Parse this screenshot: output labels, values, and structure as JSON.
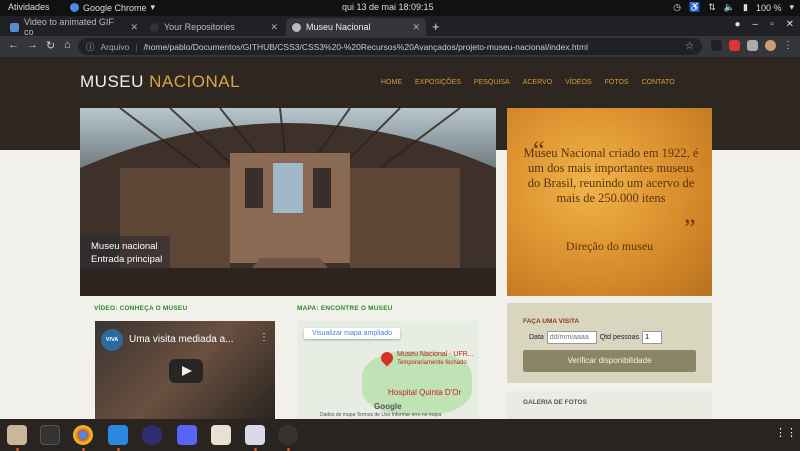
{
  "topbar": {
    "activities": "Atividades",
    "app_name": "Google Chrome",
    "clock": "qui 13 de mai  18:09:15",
    "battery": "100 %"
  },
  "tabs": [
    {
      "label": "Video to animated GIF co",
      "active": false
    },
    {
      "label": "Your Repositories",
      "active": false
    },
    {
      "label": "Museu Nacional",
      "active": true
    }
  ],
  "address": {
    "label": "Arquivo",
    "url": "/home/pablo/Documentos/GITHUB/CSS3/CSS3%20-%20Recursos%20Avançados/projeto-museu-nacional/index.html"
  },
  "site": {
    "logo_main": "MUSEU",
    "logo_accent": "NACIONAL",
    "menu": [
      "HOME",
      "EXPOSIÇÕES",
      "PESQUISA",
      "ACERVO",
      "VÍDEOS",
      "FOTOS",
      "CONTATO"
    ],
    "hero_caption_line1": "Museu nacional",
    "hero_caption_line2": "Entrada principal",
    "quote_text": "Museu Nacional criado em 1922, é um dos mais importantes museus do Brasil, reunindo um acervo de mais de 250.000 itens",
    "quote_author": "Direção do museu",
    "video_section_title": "VÍDEO: CONHEÇA O MUSEU",
    "video_title": "Uma visita mediada a...",
    "video_channel": "VIVA",
    "map_section_title": "MAPA: ENCONTRE O MUSEU",
    "map_button": "Visualizar mapa ampliado",
    "map_place": "Museu Nacional - UFR...",
    "map_place_note": "Temporariamente fechado",
    "map_hospital": "Hospital Quinta D'Or",
    "map_logo": "Google",
    "map_terms": "Dados do mapa   Termos de Uso   Informar erro no mapa",
    "visit_title": "FAÇA UMA VISITA",
    "visit_date_label": "Data",
    "visit_date_placeholder": "dd/mm/aaaa",
    "visit_qty_label": "Qtd pessoas",
    "visit_qty_value": "1",
    "visit_button": "Verificar disponibilidade",
    "gallery_title": "GALERIA DE FOTOS"
  }
}
